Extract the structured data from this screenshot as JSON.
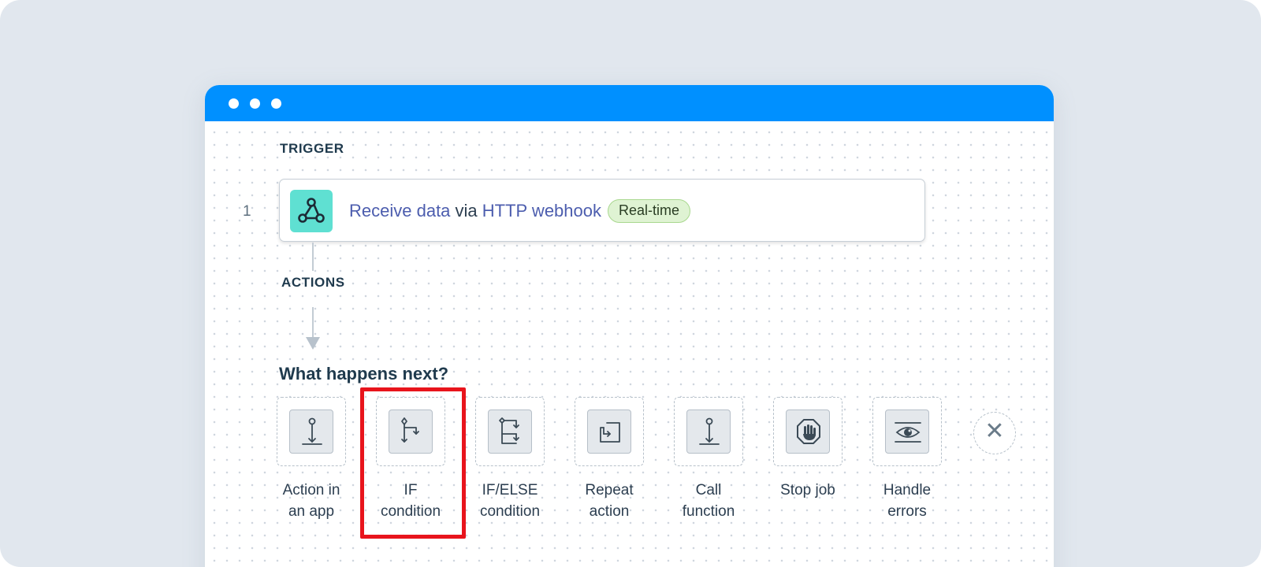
{
  "trigger": {
    "section_label": "TRIGGER",
    "step_number": "1",
    "receive_link": "Receive data",
    "via": " via ",
    "webhook_link": "HTTP webhook",
    "badge": "Real-time",
    "icon": "webhook-icon"
  },
  "actions": {
    "section_label": "ACTIONS",
    "question": "What happens next?",
    "options": [
      {
        "line1": "Action in",
        "line2": "an app",
        "icon": "action-in-app-icon"
      },
      {
        "line1": "IF",
        "line2": "condition",
        "icon": "if-condition-icon",
        "highlighted": true
      },
      {
        "line1": "IF/ELSE",
        "line2": "condition",
        "icon": "if-else-condition-icon"
      },
      {
        "line1": "Repeat",
        "line2": "action",
        "icon": "repeat-action-icon"
      },
      {
        "line1": "Call",
        "line2": "function",
        "icon": "call-function-icon"
      },
      {
        "line1": "Stop job",
        "line2": "",
        "icon": "stop-job-icon"
      },
      {
        "line1": "Handle",
        "line2": "errors",
        "icon": "handle-errors-icon"
      }
    ],
    "close_symbol": "✕"
  },
  "colors": {
    "titlebar": "#0090ff",
    "link": "#4c5dae",
    "highlight": "#e8141c",
    "badge_bg": "#dff3d3",
    "webhook_icon_bg": "#5fe0d2"
  }
}
